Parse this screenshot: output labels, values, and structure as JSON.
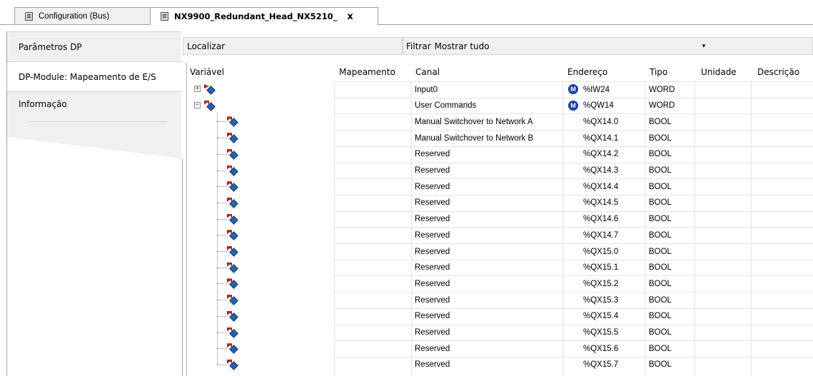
{
  "tabs": [
    {
      "label": "Configuration (Bus)"
    },
    {
      "label": "NX9900_Redundant_Head_NX5210_",
      "close_label": "x"
    }
  ],
  "nav": [
    {
      "label": "Parâmetros DP"
    },
    {
      "label": "DP-Module: Mapeamento de E/S"
    },
    {
      "label": "Informação"
    }
  ],
  "filterbar": {
    "find_label": "Localizar",
    "filter_label": "Filtrar",
    "filter_value": "Mostrar tudo",
    "dropdown_glyph": "▾"
  },
  "columns": [
    "Variável",
    "Mapeamento",
    "Canal",
    "Endereço",
    "Tipo",
    "Unidade",
    "Descrição"
  ],
  "badge_letter": "M",
  "expander_plus": "+",
  "expander_minus": "−",
  "rows": [
    {
      "canal": "Input0",
      "endereco": "%IW24",
      "tipo": "WORD",
      "level": 0,
      "expander": "plus",
      "badge": true,
      "dir": "in"
    },
    {
      "canal": "User Commands",
      "endereco": "%QW14",
      "tipo": "WORD",
      "level": 0,
      "expander": "minus",
      "badge": true,
      "dir": "out"
    },
    {
      "canal": "Manual Switchover to Network A",
      "endereco": "%QX14.0",
      "tipo": "BOOL",
      "level": 1
    },
    {
      "canal": "Manual Switchover to Network B",
      "endereco": "%QX14.1",
      "tipo": "BOOL",
      "level": 1
    },
    {
      "canal": "Reserved",
      "endereco": "%QX14.2",
      "tipo": "BOOL",
      "level": 1
    },
    {
      "canal": "Reserved",
      "endereco": "%QX14.3",
      "tipo": "BOOL",
      "level": 1
    },
    {
      "canal": "Reserved",
      "endereco": "%QX14.4",
      "tipo": "BOOL",
      "level": 1
    },
    {
      "canal": "Reserved",
      "endereco": "%QX14.5",
      "tipo": "BOOL",
      "level": 1
    },
    {
      "canal": "Reserved",
      "endereco": "%QX14.6",
      "tipo": "BOOL",
      "level": 1
    },
    {
      "canal": "Reserved",
      "endereco": "%QX14.7",
      "tipo": "BOOL",
      "level": 1
    },
    {
      "canal": "Reserved",
      "endereco": "%QX15.0",
      "tipo": "BOOL",
      "level": 1
    },
    {
      "canal": "Reserved",
      "endereco": "%QX15.1",
      "tipo": "BOOL",
      "level": 1
    },
    {
      "canal": "Reserved",
      "endereco": "%QX15.2",
      "tipo": "BOOL",
      "level": 1
    },
    {
      "canal": "Reserved",
      "endereco": "%QX15.3",
      "tipo": "BOOL",
      "level": 1
    },
    {
      "canal": "Reserved",
      "endereco": "%QX15.4",
      "tipo": "BOOL",
      "level": 1
    },
    {
      "canal": "Reserved",
      "endereco": "%QX15.5",
      "tipo": "BOOL",
      "level": 1
    },
    {
      "canal": "Reserved",
      "endereco": "%QX15.6",
      "tipo": "BOOL",
      "level": 1
    },
    {
      "canal": "Reserved",
      "endereco": "%QX15.7",
      "tipo": "BOOL",
      "level": 1
    }
  ],
  "colors": {
    "badge": "#1f3aa8",
    "variable_icon": "#2b5fa8",
    "arrow": "#b02020",
    "panel_bg": "#f0f0f0"
  }
}
